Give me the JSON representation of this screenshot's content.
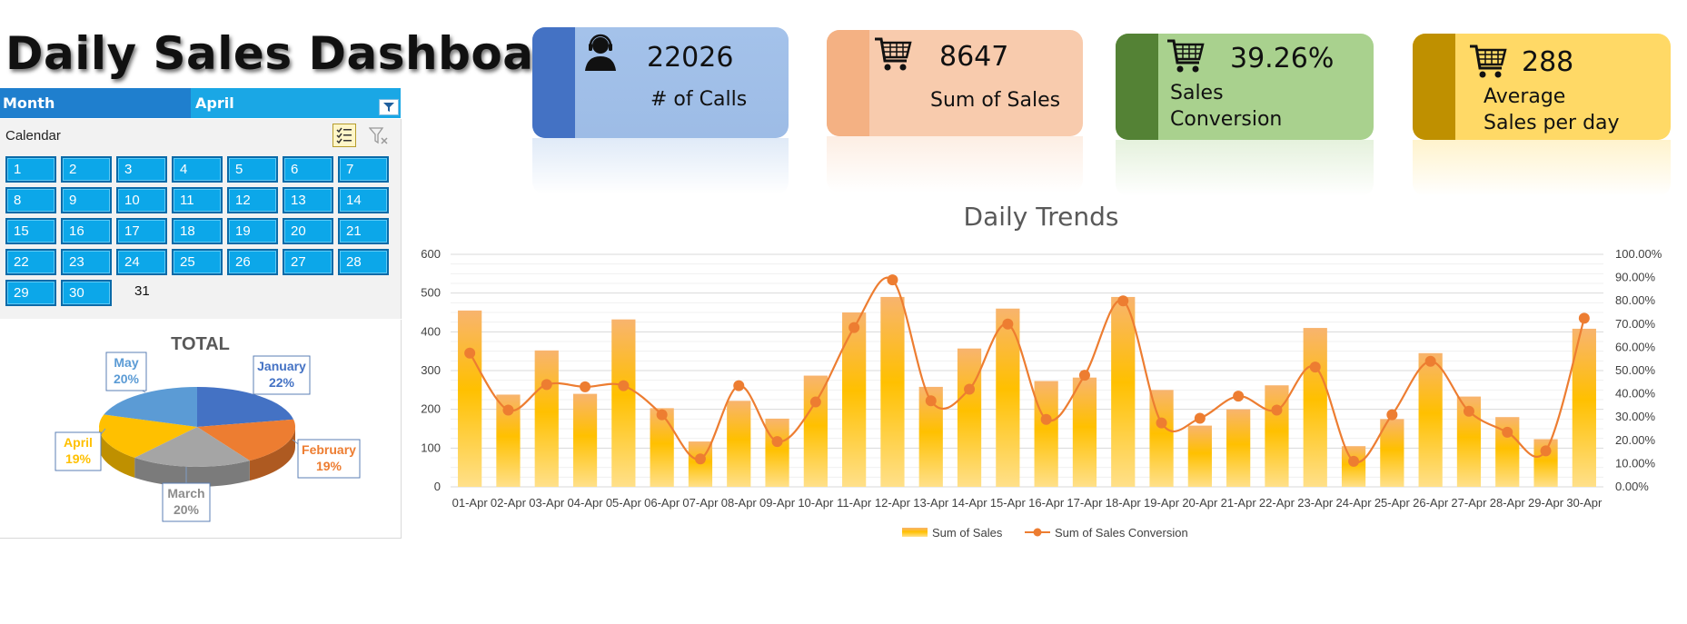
{
  "title": "Daily Sales Dashboard",
  "slicer": {
    "field_label": "Month",
    "selected_value": "April"
  },
  "calendar": {
    "title": "Calendar",
    "days": [
      "1",
      "2",
      "3",
      "4",
      "5",
      "6",
      "7",
      "8",
      "9",
      "10",
      "11",
      "12",
      "13",
      "14",
      "15",
      "16",
      "17",
      "18",
      "19",
      "20",
      "21",
      "22",
      "23",
      "24",
      "25",
      "26",
      "27",
      "28",
      "29",
      "30",
      "31"
    ]
  },
  "pie": {
    "title": "TOTAL",
    "slices": [
      {
        "label": "January",
        "pct": "22%",
        "value": 22,
        "color": "#4472c4"
      },
      {
        "label": "February",
        "pct": "19%",
        "value": 19,
        "color": "#ed7d31"
      },
      {
        "label": "March",
        "pct": "20%",
        "value": 20,
        "color": "#a5a5a5"
      },
      {
        "label": "April",
        "pct": "19%",
        "value": 19,
        "color": "#ffc000"
      },
      {
        "label": "May",
        "pct": "20%",
        "value": 20,
        "color": "#5b9bd5"
      }
    ]
  },
  "kpis": [
    {
      "value": "22026",
      "label": "# of Calls",
      "icon": "headset-person-icon",
      "color": "#a7c4ea",
      "bar_color": "#4472c4"
    },
    {
      "value": "8647",
      "label": "Sum of Sales",
      "icon": "shopping-cart-icon",
      "color": "#f8cbad",
      "bar_color": "#f4b183"
    },
    {
      "value": "39.26%",
      "label_line1": "Sales",
      "label_line2": "Conversion",
      "icon": "shopping-cart-icon",
      "color": "#a9d18e",
      "bar_color": "#548235"
    },
    {
      "value": "288",
      "label_line1": "Average",
      "label_line2": "Sales per day",
      "icon": "shopping-cart-icon",
      "color": "#ffd966",
      "bar_color": "#bf9000"
    }
  ],
  "chart_data": {
    "type": "bar",
    "title": "Daily Trends",
    "categories": [
      "01-Apr",
      "02-Apr",
      "03-Apr",
      "04-Apr",
      "05-Apr",
      "06-Apr",
      "07-Apr",
      "08-Apr",
      "09-Apr",
      "10-Apr",
      "11-Apr",
      "12-Apr",
      "13-Apr",
      "14-Apr",
      "15-Apr",
      "16-Apr",
      "17-Apr",
      "18-Apr",
      "19-Apr",
      "20-Apr",
      "21-Apr",
      "22-Apr",
      "23-Apr",
      "24-Apr",
      "25-Apr",
      "26-Apr",
      "27-Apr",
      "28-Apr",
      "29-Apr",
      "30-Apr"
    ],
    "series": [
      {
        "name": "Sum of Sales",
        "type": "bar",
        "axis": "left",
        "color": "#ffc000",
        "values": [
          455,
          238,
          352,
          240,
          432,
          203,
          117,
          222,
          176,
          287,
          450,
          490,
          258,
          357,
          460,
          273,
          282,
          490,
          250,
          158,
          200,
          262,
          410,
          105,
          175,
          345,
          233,
          180,
          123,
          408
        ]
      },
      {
        "name": "Sum of Sales Conversion",
        "type": "line",
        "axis": "right",
        "color": "#ed7d31",
        "values": [
          57.5,
          33.0,
          44.0,
          43.0,
          43.5,
          31.0,
          12.0,
          43.5,
          19.5,
          36.5,
          68.5,
          89.0,
          37.0,
          42.0,
          70.0,
          29.0,
          48.0,
          80.0,
          27.5,
          29.5,
          39.0,
          33.0,
          51.5,
          11.0,
          31.0,
          54.0,
          32.5,
          23.5,
          15.5,
          72.5
        ]
      }
    ],
    "y_left": {
      "min": 0,
      "max": 600,
      "ticks": [
        "0",
        "100",
        "200",
        "300",
        "400",
        "500",
        "600"
      ]
    },
    "y_right": {
      "min": 0,
      "max": 100,
      "ticks": [
        "0.00%",
        "10.00%",
        "20.00%",
        "30.00%",
        "40.00%",
        "50.00%",
        "60.00%",
        "70.00%",
        "80.00%",
        "90.00%",
        "100.00%"
      ]
    },
    "grid": true,
    "legend_position": "bottom"
  }
}
